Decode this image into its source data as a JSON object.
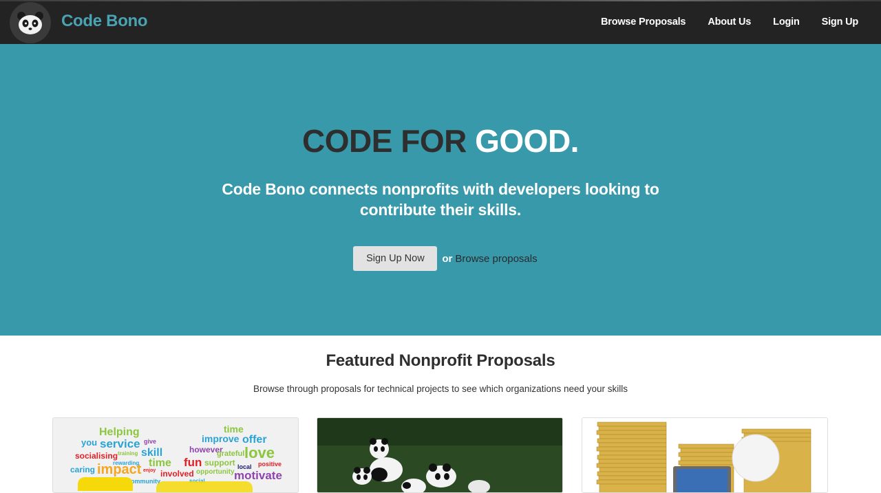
{
  "navbar": {
    "brand": "Code Bono",
    "links": [
      "Browse Proposals",
      "About Us",
      "Login",
      "Sign Up"
    ]
  },
  "hero": {
    "title_dark": "CODE FOR ",
    "title_light": "GOOD.",
    "subtitle": "Code Bono connects nonprofits with developers looking to contribute their skills.",
    "signup_button": "Sign Up Now",
    "or_text": "or",
    "browse_link": "Browse proposals"
  },
  "featured": {
    "title": "Featured Nonprofit Proposals",
    "subtitle": "Browse through proposals for technical projects to see which organizations need your skills"
  },
  "word_cloud": [
    "Helping",
    "you",
    "service",
    "give",
    "socialising",
    "training",
    "skill",
    "rewarding",
    "caring",
    "impact",
    "enjoy",
    "time",
    "improve",
    "offer",
    "however",
    "grateful",
    "love",
    "fun",
    "support",
    "positive",
    "opportunity",
    "local",
    "involved",
    "motivate",
    "community",
    "social",
    "time"
  ],
  "colors": {
    "navbar_bg": "#232323",
    "brand": "#4aa3b3",
    "hero_bg": "#3899ab",
    "button_bg": "#e2e2e2"
  }
}
